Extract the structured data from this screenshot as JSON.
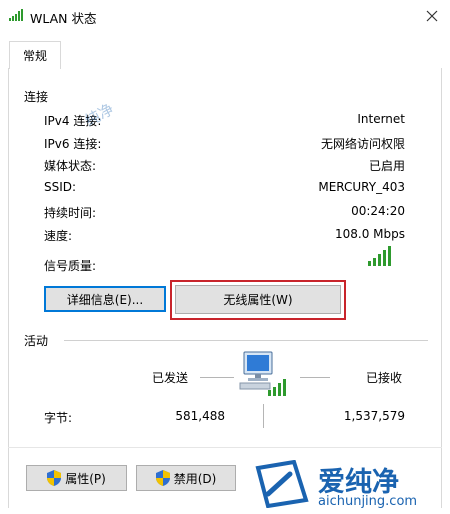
{
  "window": {
    "title": "WLAN 状态"
  },
  "tabs": [
    {
      "label": "常规"
    }
  ],
  "connection": {
    "heading": "连接",
    "rows": [
      {
        "label": "IPv4 连接:",
        "value": "Internet"
      },
      {
        "label": "IPv6 连接:",
        "value": "无网络访问权限"
      },
      {
        "label": "媒体状态:",
        "value": "已启用"
      },
      {
        "label": "SSID:",
        "value": "MERCURY_403"
      },
      {
        "label": "持续时间:",
        "value": "00:24:20"
      },
      {
        "label": "速度:",
        "value": "108.0 Mbps"
      }
    ],
    "signal_label": "信号质量:",
    "signal_bars": 5,
    "details_button": "详细信息(E)...",
    "wireless_props_button": "无线属性(W)"
  },
  "activity": {
    "heading": "活动",
    "sent_label": "已发送",
    "received_label": "已接收",
    "bytes_label": "字节:",
    "bytes_sent": "581,488",
    "bytes_received": "1,537,579"
  },
  "actions": {
    "properties_button": "属性(P)",
    "disable_button": "禁用(D)"
  },
  "watermark": {
    "brand": "爱纯净",
    "url": "aichunjing.com",
    "corner_text": "纯净"
  },
  "colors": {
    "signal": "#2e9a2e",
    "highlight": "#c8242b",
    "focus": "#0078d7",
    "watermark": "#1a63b0"
  }
}
